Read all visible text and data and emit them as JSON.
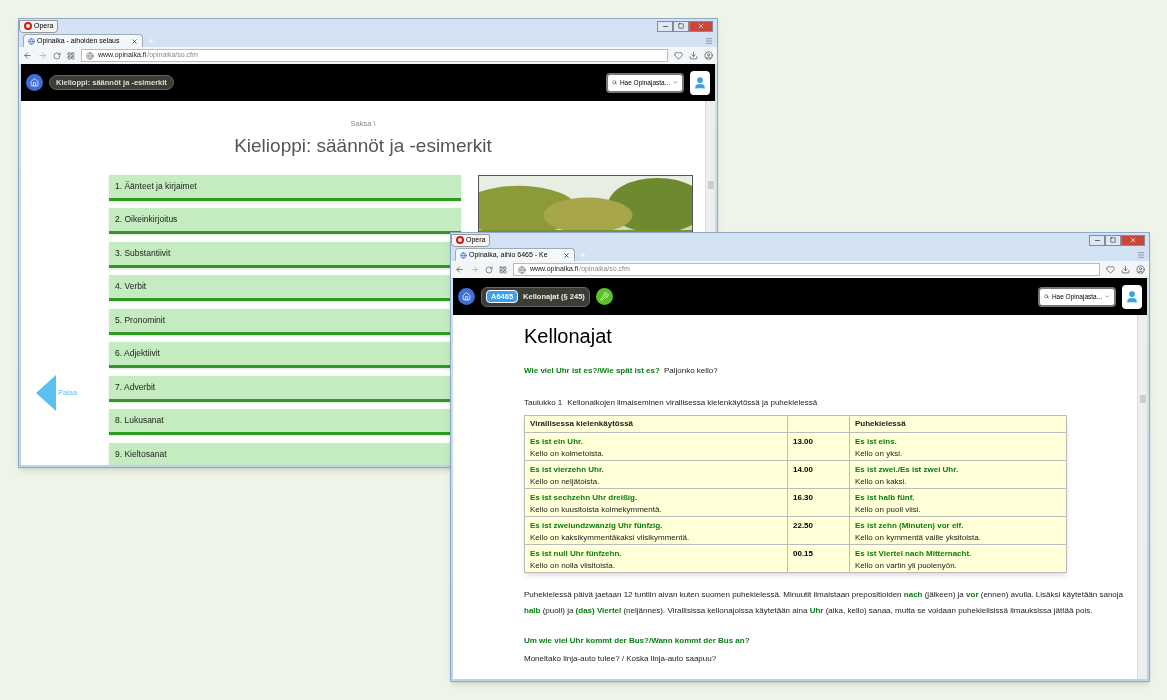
{
  "back_window": {
    "title_button": "Opera",
    "tab": {
      "title": "Opinaika - aihoiden selaus",
      "selected": true
    },
    "url": {
      "domain": "www.opinaika.fi",
      "path": "/opinaika/so.cfm"
    },
    "navbar": {
      "breadcrumb": "Kielioppi: säännöt ja -esimerkit",
      "search": {
        "placeholder": "Hae Opinajasta..."
      }
    },
    "content": {
      "path": "Saksa \\",
      "heading": "Kielioppi: säännöt ja -esimerkit",
      "back_link": "Palaa",
      "chapters": [
        "1. Äänteet ja kirjaimet",
        "2. Oikeinkirjoitus",
        "3. Substantiivit",
        "4. Verbit",
        "5. Pronominit",
        "6. Adjektiivit",
        "7. Adverbit",
        "8. Lukusanat",
        "9. Kieltosanat"
      ]
    }
  },
  "front_window": {
    "title_button": "Opera",
    "tab": {
      "title": "Opinaika, aihio 6465 - Ke",
      "selected": true
    },
    "url": {
      "domain": "www.opinaika.fi",
      "path": "/opinaika/so.cfm"
    },
    "navbar": {
      "badge": "A6465",
      "breadcrumb": "Kellonajat (§ 245)",
      "search": {
        "placeholder": "Hae Opinajasta..."
      }
    },
    "content": {
      "heading": "Kellonajat",
      "question_1": {
        "german": "Wie viel Uhr ist es?/Wie spät ist es?",
        "finnish": "Paljonko kello?"
      },
      "table": {
        "caption_label": "Taulukko 1",
        "caption": "Kellonaikojen ilmaiseminen virallisessa kielenkäytössä ja puhekielessä",
        "columns": {
          "official": "Virallisessa kielenkäytössä",
          "colloquial": "Puhekielessä"
        },
        "rows": [
          {
            "official_german": "Es ist ein Uhr.",
            "official_finnish": "Kello on kolmetoista.",
            "time": "13.00",
            "colloquial_german": "Es ist eins.",
            "colloquial_finnish": "Kello on yksi."
          },
          {
            "official_german": "Es ist vierzehn Uhr.",
            "official_finnish": "Kello on neljätoista.",
            "time": "14.00",
            "colloquial_german": "Es ist zwei./Es ist zwei Uhr.",
            "colloquial_finnish": "Kello on kaksi."
          },
          {
            "official_german": "Es ist sechzehn Uhr dreißig.",
            "official_finnish": "Kello on kuusitoista kolmekymmentä.",
            "time": "16.30",
            "colloquial_german": "Es ist halb fünf.",
            "colloquial_finnish": "Kello on puoli viisi."
          },
          {
            "official_german": "Es ist zweiundzwanzig Uhr fünfzig.",
            "official_finnish": "Kello on kaksikymmentäkaksi viisikymmentä.",
            "time": "22.50",
            "colloquial_german": "Es ist zehn (Minuten) vor elf.",
            "colloquial_finnish": "Kello on kymmentä vaille yksitoista."
          },
          {
            "official_german": "Es ist null Uhr fünfzehn.",
            "official_finnish": "Kello on nolla viisitoista.",
            "time": "00.15",
            "colloquial_german": "Es ist Viertel nach Mitternacht.",
            "colloquial_finnish": "Kello on vartin yli puolenyön."
          }
        ]
      },
      "paragraph": "Puhekielessä päivä jaetaan 12 tuntiin aivan kuten suomen puhekielessä. Minuutit ilmaistaan prepositioiden **nach** (jälkeen) ja **vor** (ennen) avulla. Lisäksi käytetään sanoja **halb** (puoli) ja **(das) Viertel** (neljännes). Virallisissa kellonajoissa käytetään aina **Uhr** (aika, kello) sanaa, mutta se voidaan puhekielisissä ilmauksissa jättää pois.",
      "question_2": {
        "german": "Um wie viel Uhr kommt der Bus?/Wann kommt der Bus an?",
        "finnish": "Moneltako linja-auto tulee? / Koska linja-auto saapuu?"
      }
    }
  }
}
